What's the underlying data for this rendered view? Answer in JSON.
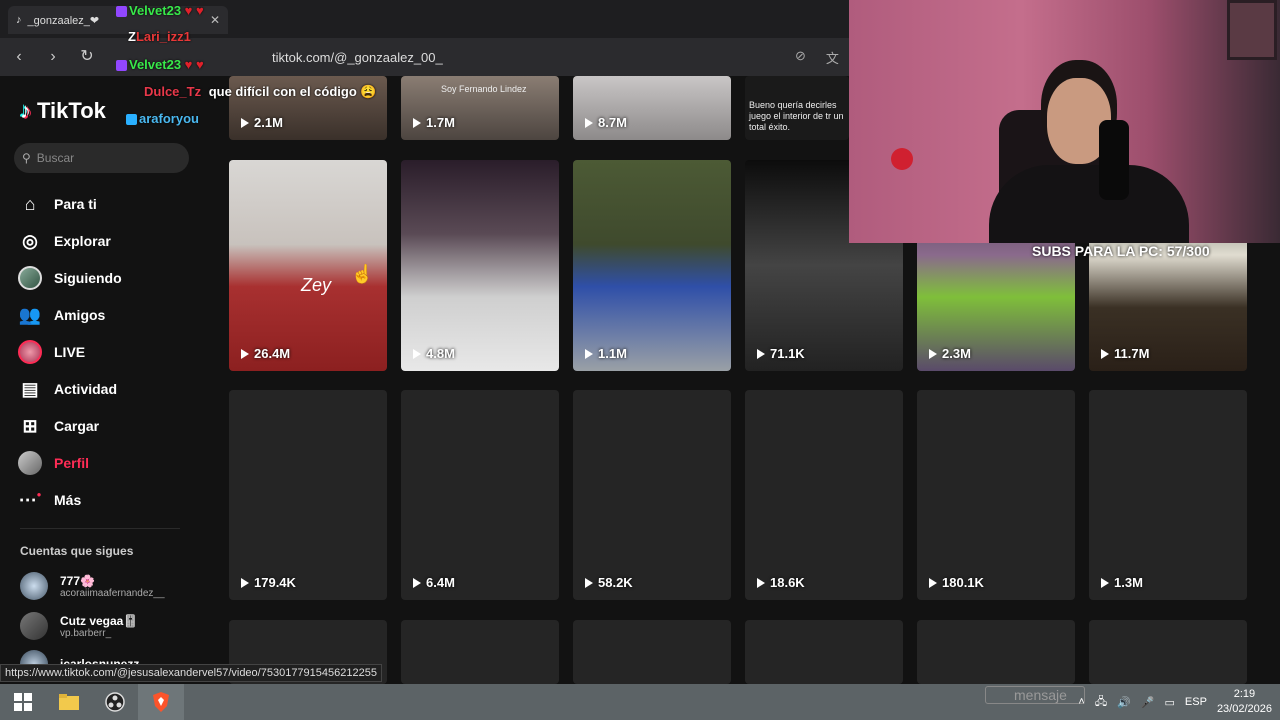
{
  "browser": {
    "tab_title": "_gonzaalez_❤",
    "url": "tiktok.com/@_gonzaalez_00_",
    "status_url": "https://www.tiktok.com/@jesusalexandervel57/video/7530177915456212255"
  },
  "chat": [
    {
      "user": "Velvet23",
      "message": "",
      "color": "#38e84a"
    },
    {
      "user": "Lari_izz1",
      "message": "",
      "color": "#e83838"
    },
    {
      "user": "Velvet23",
      "message": "",
      "color": "#38e84a"
    },
    {
      "user": "Dulce_Tz",
      "message": "que difícil con el código 😩",
      "color": "#e8384a"
    },
    {
      "user": "araforyou",
      "message": "",
      "color": "#4ab8f0"
    }
  ],
  "sidebar": {
    "logo": "TikTok",
    "search_placeholder": "Buscar",
    "items": [
      {
        "label": "Para ti",
        "icon": "home-icon",
        "active": false
      },
      {
        "label": "Explorar",
        "icon": "compass-icon",
        "active": false
      },
      {
        "label": "Siguiendo",
        "icon": "following-avatar",
        "active": false
      },
      {
        "label": "Amigos",
        "icon": "friends-icon",
        "active": false
      },
      {
        "label": "LIVE",
        "icon": "live-avatar",
        "active": false
      },
      {
        "label": "Actividad",
        "icon": "activity-icon",
        "active": false
      },
      {
        "label": "Cargar",
        "icon": "upload-icon",
        "active": false
      },
      {
        "label": "Perfil",
        "icon": "profile-avatar",
        "active": true
      },
      {
        "label": "Más",
        "icon": "more-icon",
        "active": false
      }
    ],
    "following_title": "Cuentas que sigues",
    "following": [
      {
        "name": "777🌸",
        "handle": "acoraiimaafernandez__"
      },
      {
        "name": "Cutz vegaa🎚️",
        "handle": "vp.barberr_"
      },
      {
        "name": "icarlosnunezz",
        "handle": ""
      }
    ]
  },
  "videos": {
    "row0": [
      {
        "views": "2.1M",
        "caption": ""
      },
      {
        "views": "1.7M",
        "caption": "Soy Fernando Lindez"
      },
      {
        "views": "8.7M",
        "caption": ""
      },
      {
        "views": "",
        "caption": "Bueno quería decirles juego el interior de tr un total éxito."
      }
    ],
    "row1": [
      {
        "views": "26.4M",
        "caption": "Zey"
      },
      {
        "views": "4.8M",
        "caption": ""
      },
      {
        "views": "1.1M",
        "caption": ""
      },
      {
        "views": "71.1K",
        "caption": ""
      },
      {
        "views": "2.3M",
        "caption": ""
      },
      {
        "views": "11.7M",
        "caption": ""
      }
    ],
    "row2": [
      {
        "views": "179.4K"
      },
      {
        "views": "6.4M"
      },
      {
        "views": "58.2K"
      },
      {
        "views": "18.6K"
      },
      {
        "views": "180.1K"
      },
      {
        "views": "1.3M"
      }
    ]
  },
  "overlay": {
    "subs_goal": "SUBS PARA LA PC: 57/300"
  },
  "taskbar": {
    "search_hint": "mensaje",
    "language": "ESP",
    "time": "2:19",
    "date": "23/02/2026"
  },
  "colors": {
    "accent": "#fe2c55",
    "background": "#121212",
    "tile": "#252525"
  }
}
